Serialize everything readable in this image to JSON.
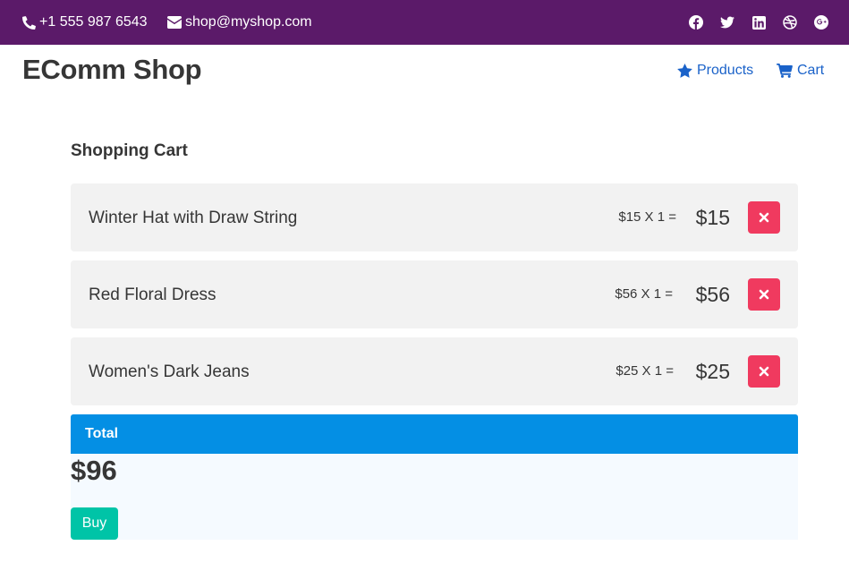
{
  "topbar": {
    "phone": "+1 555 987 6543",
    "email": "shop@myshop.com",
    "socials": [
      "facebook-icon",
      "twitter-icon",
      "linkedin-icon",
      "dribbble-icon",
      "google-plus-icon"
    ]
  },
  "brand": "EComm Shop",
  "nav": {
    "products": "Products",
    "cart": "Cart"
  },
  "cart": {
    "title": "Shopping Cart",
    "items": [
      {
        "name": "Winter Hat with Draw String",
        "calc": "$15 X 1 =",
        "subtotal": "$15"
      },
      {
        "name": "Red Floral Dress",
        "calc": "$56 X 1 =",
        "subtotal": "$56"
      },
      {
        "name": "Women's Dark Jeans",
        "calc": "$25 X 1 =",
        "subtotal": "$25"
      }
    ],
    "total_label": "Total",
    "total_amount": "$96",
    "buy_label": "Buy"
  },
  "colors": {
    "topbar": "#5b1a69",
    "link": "#1a62c9",
    "remove": "#f03a5f",
    "total_header": "#048fe4",
    "buy": "#00c4a7"
  }
}
